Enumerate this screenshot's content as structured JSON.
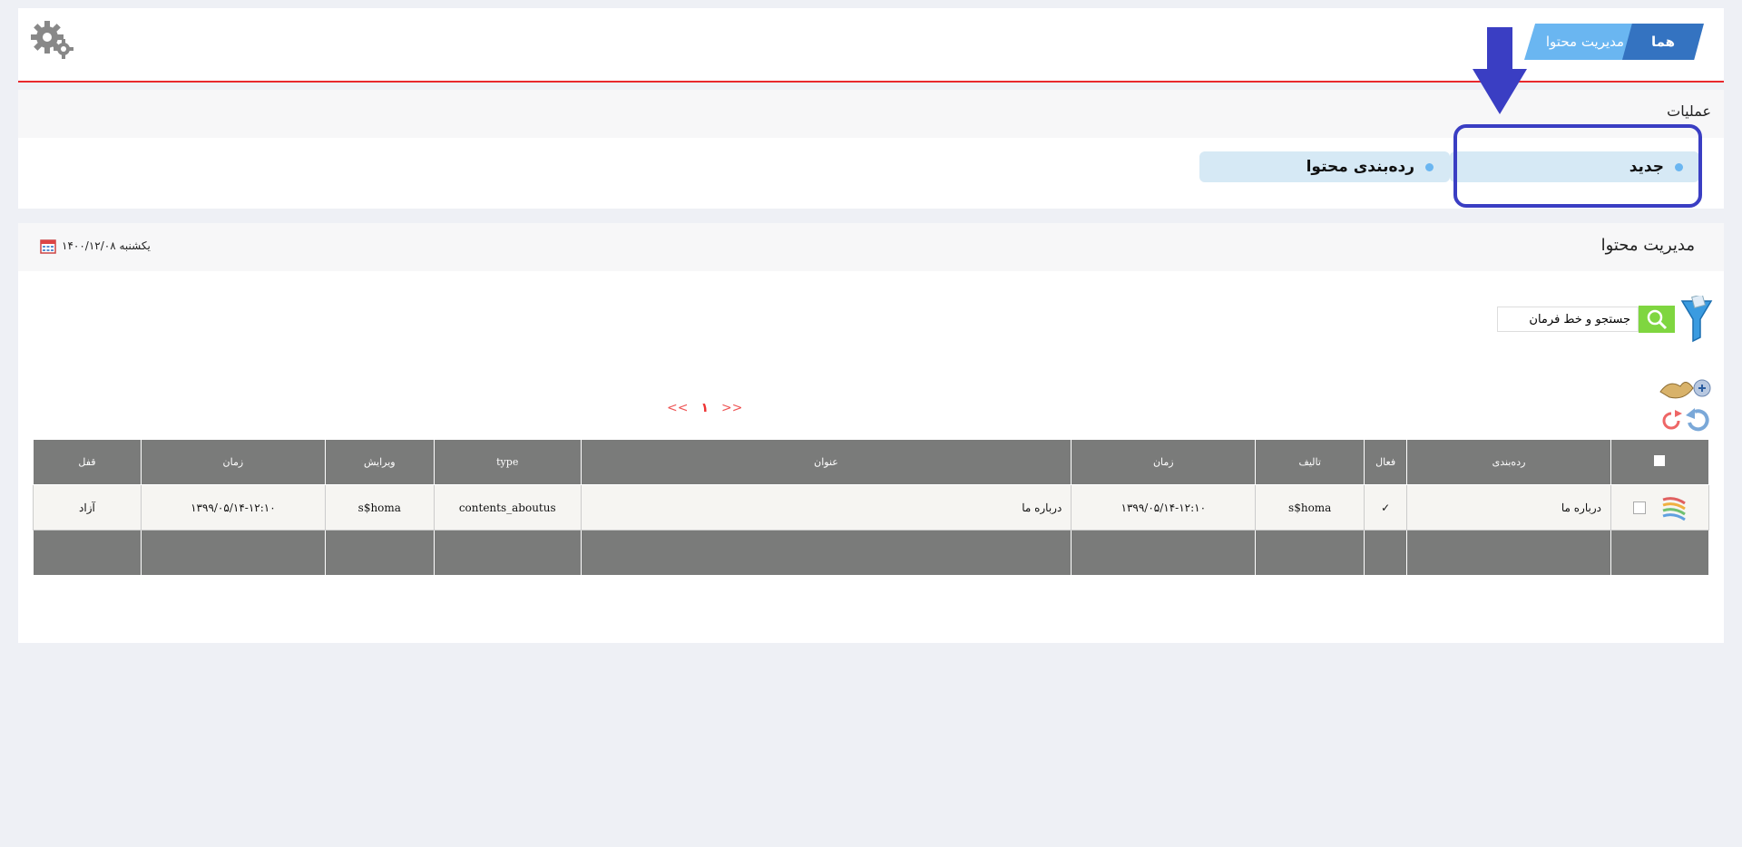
{
  "breadcrumb": {
    "home": "هما",
    "current": "مدیریت محتوا"
  },
  "operations": {
    "title": "عملیات",
    "new_label": "جدید",
    "categorize_label": "رده‌بندی محتوا"
  },
  "main": {
    "title": "مدیریت محتوا",
    "date": "یکشنبه ۱۴۰۰/۱۲/۰۸",
    "search_label": "جستجو و خط فرمان"
  },
  "pager": {
    "prev": "<<",
    "current": "۱",
    "next": ">>"
  },
  "table": {
    "headers": {
      "category": "رده‌بندی",
      "active": "فعال",
      "author": "تالیف",
      "time": "زمان",
      "title": "عنوان",
      "type": "type",
      "editor": "ویرایش",
      "time2": "زمان",
      "lock": "قفل"
    },
    "rows": [
      {
        "category": "درباره ما",
        "active": "✓",
        "author": "s$homa",
        "time": "۱۳۹۹/۰۵/۱۴-۱۲:۱۰",
        "title": "درباره ما",
        "type": "contents_aboutus",
        "editor": "s$homa",
        "time2": "۱۳۹۹/۰۵/۱۴-۱۲:۱۰",
        "lock": "آزاد"
      }
    ]
  },
  "colors": {
    "accent": "#3473c1",
    "breadcrumb_light": "#6ab6f1",
    "divider": "#e8282c",
    "annotation": "#3a3ec3"
  }
}
